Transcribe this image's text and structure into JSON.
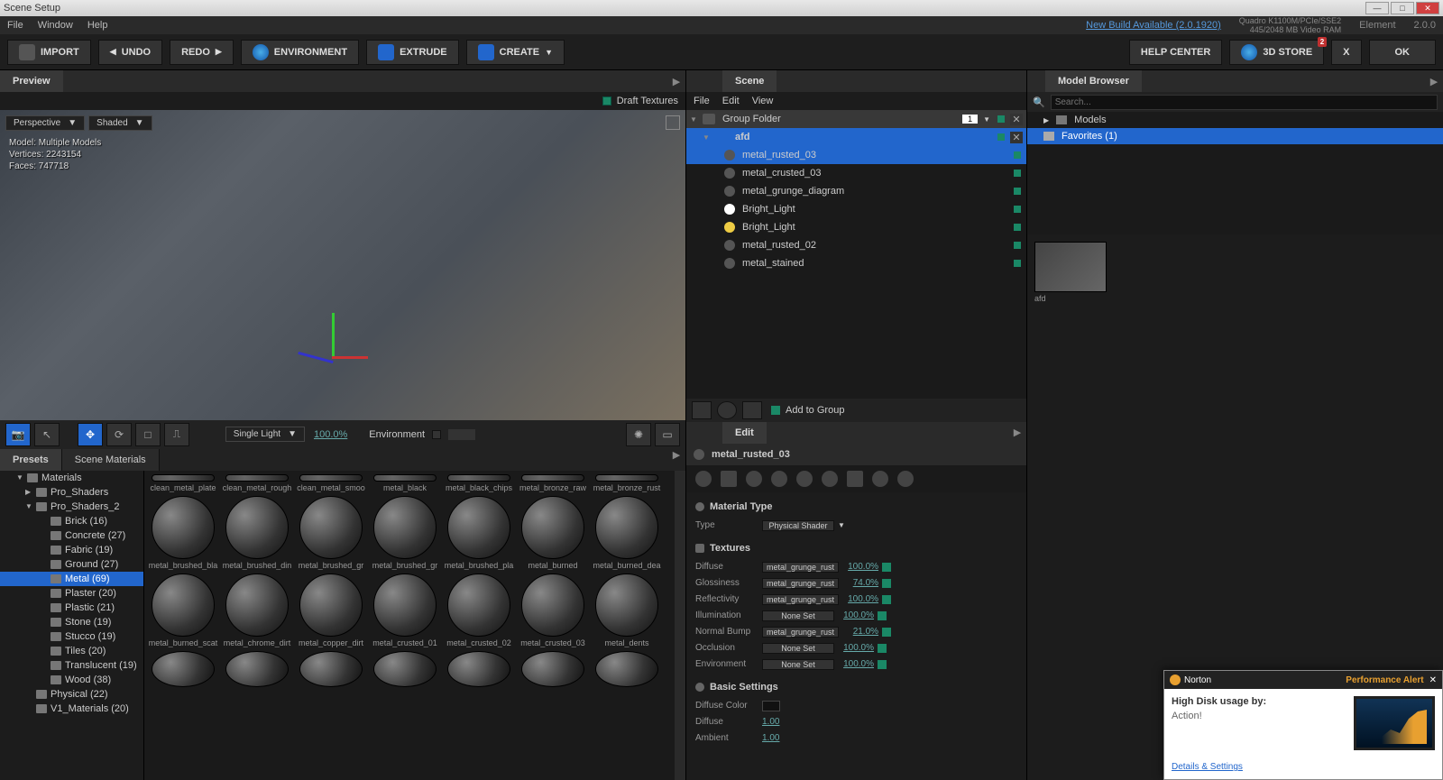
{
  "window": {
    "title": "Scene Setup"
  },
  "menubar": {
    "items": [
      "File",
      "Window",
      "Help"
    ],
    "newBuild": "New Build Available (2.0.1920)",
    "gpu": {
      "line1": "Quadro K1100M/PCIe/SSE2",
      "line2": "445/2048 MB Video RAM"
    },
    "app": "Element",
    "version": "2.0.0"
  },
  "toolbar": {
    "import": "IMPORT",
    "undo": "UNDO",
    "redo": "REDO",
    "environment": "ENVIRONMENT",
    "extrude": "EXTRUDE",
    "create": "CREATE",
    "helpCenter": "HELP CENTER",
    "store": "3D STORE",
    "storeBadge": "2",
    "x": "X",
    "ok": "OK"
  },
  "preview": {
    "title": "Preview",
    "draftTextures": "Draft Textures",
    "camera": "Perspective",
    "shading": "Shaded",
    "stats": {
      "model": "Model:  Multiple Models",
      "vertices": "Vertices:  2243154",
      "faces": "Faces:  747718"
    },
    "lightMode": "Single Light",
    "lightPct": "100.0%",
    "envLabel": "Environment"
  },
  "scene": {
    "title": "Scene",
    "menu": [
      "File",
      "Edit",
      "View"
    ],
    "groupFolder": "Group Folder",
    "groupCount": "1",
    "group": "afd",
    "items": [
      {
        "name": "metal_rusted_03",
        "type": "sphere",
        "sel": true
      },
      {
        "name": "metal_crusted_03",
        "type": "sphere"
      },
      {
        "name": "metal_grunge_diagram",
        "type": "sphere"
      },
      {
        "name": "Bright_Light",
        "type": "light"
      },
      {
        "name": "Bright_Light",
        "type": "light-y"
      },
      {
        "name": "metal_rusted_02",
        "type": "sphere"
      },
      {
        "name": "metal_stained",
        "type": "sphere"
      }
    ],
    "addToGroup": "Add to Group"
  },
  "edit": {
    "title": "Edit",
    "material": "metal_rusted_03",
    "matTypeHead": "Material Type",
    "typeLabel": "Type",
    "typeValue": "Physical Shader",
    "texturesHead": "Textures",
    "texRows": [
      {
        "label": "Diffuse",
        "map": "metal_grunge_rust",
        "pct": "100.0%"
      },
      {
        "label": "Glossiness",
        "map": "metal_grunge_rust",
        "pct": "74.0%"
      },
      {
        "label": "Reflectivity",
        "map": "metal_grunge_rust",
        "pct": "100.0%"
      },
      {
        "label": "Illumination",
        "map": "None Set",
        "pct": "100.0%"
      },
      {
        "label": "Normal Bump",
        "map": "metal_grunge_rust",
        "pct": "21.0%"
      },
      {
        "label": "Occlusion",
        "map": "None Set",
        "pct": "100.0%"
      },
      {
        "label": "Environment",
        "map": "None Set",
        "pct": "100.0%"
      }
    ],
    "basicHead": "Basic Settings",
    "basicRows": [
      {
        "label": "Diffuse Color",
        "swatch": true
      },
      {
        "label": "Diffuse",
        "num": "1.00"
      },
      {
        "label": "Ambient",
        "num": "1.00"
      }
    ]
  },
  "modelBrowser": {
    "title": "Model Browser",
    "searchPlaceholder": "Search...",
    "rows": [
      {
        "label": "Models",
        "sel": false
      },
      {
        "label": "Favorites (1)",
        "sel": true
      }
    ],
    "thumbLabel": "afd"
  },
  "presets": {
    "tabs": [
      "Presets",
      "Scene Materials"
    ],
    "tree": [
      {
        "label": "Materials",
        "depth": 0,
        "open": true
      },
      {
        "label": "Pro_Shaders",
        "depth": 1,
        "open": false
      },
      {
        "label": "Pro_Shaders_2",
        "depth": 1,
        "open": true
      },
      {
        "label": "Brick (16)",
        "depth": 2
      },
      {
        "label": "Concrete (27)",
        "depth": 2
      },
      {
        "label": "Fabric (19)",
        "depth": 2
      },
      {
        "label": "Ground (27)",
        "depth": 2
      },
      {
        "label": "Metal (69)",
        "depth": 2,
        "sel": true
      },
      {
        "label": "Plaster (20)",
        "depth": 2
      },
      {
        "label": "Plastic (21)",
        "depth": 2
      },
      {
        "label": "Stone (19)",
        "depth": 2
      },
      {
        "label": "Stucco (19)",
        "depth": 2
      },
      {
        "label": "Tiles (20)",
        "depth": 2
      },
      {
        "label": "Translucent (19)",
        "depth": 2
      },
      {
        "label": "Wood (38)",
        "depth": 2
      },
      {
        "label": "Physical (22)",
        "depth": 1
      },
      {
        "label": "V1_Materials (20)",
        "depth": 1
      }
    ],
    "gridRow0": [
      "clean_metal_plate",
      "clean_metal_rough",
      "clean_metal_smoo",
      "metal_black",
      "metal_black_chips",
      "metal_bronze_raw",
      "metal_bronze_rust"
    ],
    "gridRow1": [
      "metal_brushed_bla",
      "metal_brushed_din",
      "metal_brushed_gr",
      "metal_brushed_gr",
      "metal_brushed_pla",
      "metal_burned",
      "metal_burned_dea"
    ],
    "gridRow2": [
      "metal_burned_scat",
      "metal_chrome_dirt",
      "metal_copper_dirt",
      "metal_crusted_01",
      "metal_crusted_02",
      "metal_crusted_03",
      "metal_dents"
    ]
  },
  "toast": {
    "brand": "Norton",
    "alert": "Performance Alert",
    "heading": "High Disk usage by:",
    "process": "Action!",
    "link": "Details & Settings"
  }
}
